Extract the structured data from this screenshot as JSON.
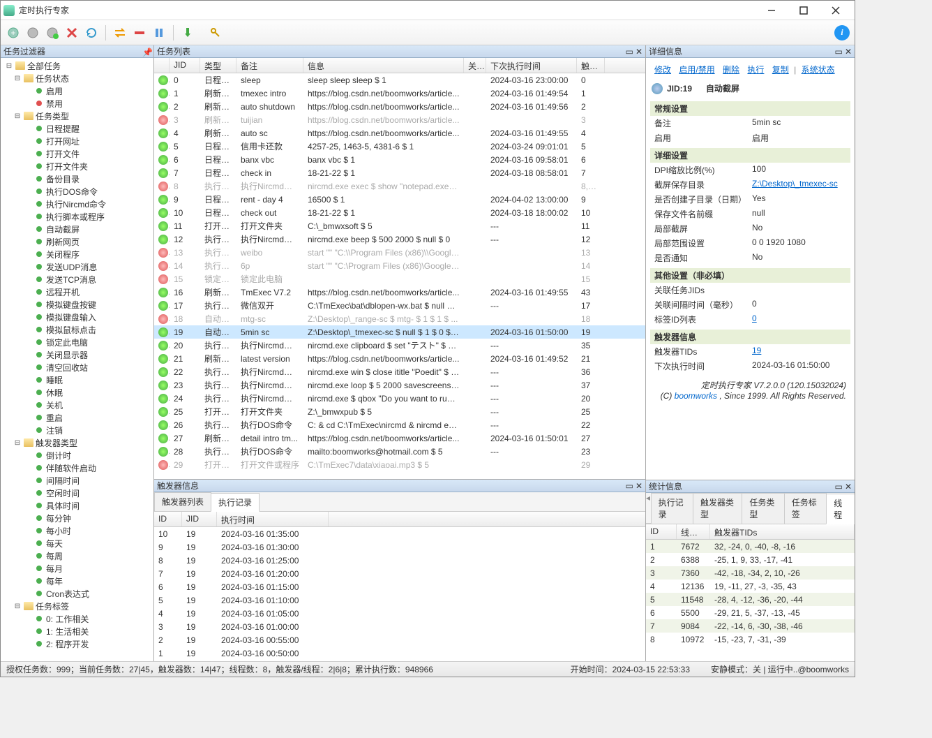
{
  "window": {
    "title": "定时执行专家"
  },
  "panes": {
    "filter": "任务过滤器",
    "tasks": "任务列表",
    "trig": "触发器信息",
    "detail": "详细信息",
    "stats": "统计信息"
  },
  "tree": {
    "all": "全部任务",
    "status": {
      "label": "任务状态",
      "enable": "启用",
      "disable": "禁用"
    },
    "types": {
      "label": "任务类型",
      "items": [
        "日程提醒",
        "打开网址",
        "打开文件",
        "打开文件夹",
        "备份目录",
        "执行DOS命令",
        "执行Nircmd命令",
        "执行脚本或程序",
        "自动截屏",
        "刷新网页",
        "关闭程序",
        "发送UDP消息",
        "发送TCP消息",
        "远程开机",
        "模拟键盘按键",
        "模拟键盘输入",
        "模拟鼠标点击",
        "锁定此电脑",
        "关闭显示器",
        "清空回收站",
        "睡眠",
        "休眠",
        "关机",
        "重启",
        "注销"
      ]
    },
    "trigtypes": {
      "label": "触发器类型",
      "items": [
        "倒计时",
        "伴随软件启动",
        "间隔时间",
        "空闲时间",
        "具体时间",
        "每分钟",
        "每小时",
        "每天",
        "每周",
        "每月",
        "每年",
        "Cron表达式"
      ]
    },
    "tags": {
      "label": "任务标签",
      "items": [
        "0: 工作相关",
        "1: 生活相关",
        "2: 程序开发"
      ]
    }
  },
  "taskCols": {
    "jid": "JID",
    "type": "类型",
    "remark": "备注",
    "info": "信息",
    "rel": "关...",
    "next": "下次执行时间",
    "trig": "触发..."
  },
  "tasks": [
    {
      "jid": 0,
      "on": true,
      "type": "日程提...",
      "remark": "sleep",
      "info": "sleep sleep sleep $ 1",
      "next": "2024-03-16 23:00:00",
      "trig": "0"
    },
    {
      "jid": 1,
      "on": true,
      "type": "刷新网...",
      "remark": "tmexec intro",
      "info": "https://blog.csdn.net/boomworks/article...",
      "next": "2024-03-16 01:49:54",
      "trig": "1"
    },
    {
      "jid": 2,
      "on": true,
      "type": "刷新网...",
      "remark": "auto shutdown",
      "info": "https://blog.csdn.net/boomworks/article...",
      "next": "2024-03-16 01:49:56",
      "trig": "2"
    },
    {
      "jid": 3,
      "on": false,
      "dis": true,
      "type": "刷新网...",
      "remark": "tuijian",
      "info": "https://blog.csdn.net/boomworks/article...",
      "next": "",
      "trig": "3"
    },
    {
      "jid": 4,
      "on": true,
      "type": "刷新网...",
      "remark": "auto sc",
      "info": "https://blog.csdn.net/boomworks/article...",
      "next": "2024-03-16 01:49:55",
      "trig": "4"
    },
    {
      "jid": 5,
      "on": true,
      "type": "日程提...",
      "remark": "信用卡还款",
      "info": "4257-25, 1463-5, 4381-6 $ 1",
      "next": "2024-03-24 09:01:01",
      "trig": "5"
    },
    {
      "jid": 6,
      "on": true,
      "type": "日程提...",
      "remark": "banx vbc",
      "info": "banx vbc $ 1",
      "next": "2024-03-16 09:58:01",
      "trig": "6"
    },
    {
      "jid": 7,
      "on": true,
      "type": "日程提...",
      "remark": "check in",
      "info": "18-21-22 $ 1",
      "next": "2024-03-18 08:58:01",
      "trig": "7"
    },
    {
      "jid": 8,
      "on": false,
      "dis": true,
      "type": "执行Ni...",
      "remark": "执行Nircmd命令",
      "info": "nircmd.exe exec $ show \"notepad.exe\" $...",
      "next": "",
      "trig": "8,16,..."
    },
    {
      "jid": 9,
      "on": true,
      "type": "日程提...",
      "remark": "rent - day 4",
      "info": "16500 $ 1",
      "next": "2024-04-02 13:00:00",
      "trig": "9"
    },
    {
      "jid": 10,
      "on": true,
      "type": "日程提...",
      "remark": "check out",
      "info": "18-21-22 $ 1",
      "next": "2024-03-18 18:00:02",
      "trig": "10"
    },
    {
      "jid": 11,
      "on": true,
      "type": "打开文...",
      "remark": "打开文件夹",
      "info": "C:\\_bmwxsoft $ 5",
      "next": "---",
      "trig": "11"
    },
    {
      "jid": 12,
      "on": true,
      "type": "执行Ni...",
      "remark": "执行Nircmd命令",
      "info": "nircmd.exe beep $ 500 2000 $ null $ 0",
      "next": "---",
      "trig": "12"
    },
    {
      "jid": 13,
      "on": false,
      "dis": true,
      "type": "执行D...",
      "remark": "weibo",
      "info": "start \"\" \"C:\\\\Program Files (x86)\\\\Google...",
      "next": "",
      "trig": "13"
    },
    {
      "jid": 14,
      "on": false,
      "dis": true,
      "type": "执行D...",
      "remark": "6p",
      "info": "start \"\" \"C:\\Program Files (x86)\\Google\\...",
      "next": "",
      "trig": "14"
    },
    {
      "jid": 15,
      "on": false,
      "dis": true,
      "type": "锁定此...",
      "remark": "锁定此电脑",
      "info": "",
      "next": "",
      "trig": "15"
    },
    {
      "jid": 16,
      "on": true,
      "type": "刷新网...",
      "remark": "TmExec V7.2",
      "info": "https://blog.csdn.net/boomworks/article...",
      "next": "2024-03-16 01:49:55",
      "trig": "43"
    },
    {
      "jid": 17,
      "on": true,
      "type": "执行脚...",
      "remark": "微信双开",
      "info": "C:\\TmExec\\bat\\dblopen-wx.bat $ null $ ...",
      "next": "---",
      "trig": "17"
    },
    {
      "jid": 18,
      "on": false,
      "dis": true,
      "type": "自动截...",
      "remark": "mtg-sc",
      "info": "Z:\\Desktop\\_range-sc $ mtg- $ 1 $ 1 $ ...",
      "next": "",
      "trig": "18"
    },
    {
      "jid": 19,
      "on": true,
      "sel": true,
      "type": "自动截...",
      "remark": "5min sc",
      "info": "Z:\\Desktop\\_tmexec-sc $ null $ 1 $ 0 $ 0...",
      "next": "2024-03-16 01:50:00",
      "trig": "19"
    },
    {
      "jid": 20,
      "on": true,
      "type": "执行Ni...",
      "remark": "执行Nircmd命令",
      "info": "nircmd.exe clipboard $ set \"テスト\" $ C:\\...",
      "next": "---",
      "trig": "35"
    },
    {
      "jid": 21,
      "on": true,
      "type": "刷新网...",
      "remark": "latest version",
      "info": "https://blog.csdn.net/boomworks/article...",
      "next": "2024-03-16 01:49:52",
      "trig": "21"
    },
    {
      "jid": 22,
      "on": true,
      "type": "执行Ni...",
      "remark": "执行Nircmd命令",
      "info": "nircmd.exe win $ close ititle \"Poedit\" $ n...",
      "next": "---",
      "trig": "36"
    },
    {
      "jid": 23,
      "on": true,
      "type": "执行Ni...",
      "remark": "执行Nircmd命令",
      "info": "nircmd.exe loop $ 5 2000 savescreensh...",
      "next": "---",
      "trig": "37"
    },
    {
      "jid": 24,
      "on": true,
      "type": "执行Ni...",
      "remark": "执行Nircmd命令",
      "info": "nircmd.exe $ qbox \"Do you want to run ...",
      "next": "---",
      "trig": "20"
    },
    {
      "jid": 25,
      "on": true,
      "type": "打开文...",
      "remark": "打开文件夹",
      "info": "Z:\\_bmwxpub $ 5",
      "next": "---",
      "trig": "25"
    },
    {
      "jid": 26,
      "on": true,
      "type": "执行D...",
      "remark": "执行DOS命令",
      "info": "C: & cd C:\\TmExec\\nircmd & nircmd exe...",
      "next": "---",
      "trig": "22"
    },
    {
      "jid": 27,
      "on": true,
      "type": "刷新网...",
      "remark": "detail intro tm...",
      "info": "https://blog.csdn.net/boomworks/article...",
      "next": "2024-03-16 01:50:01",
      "trig": "27"
    },
    {
      "jid": 28,
      "on": true,
      "type": "执行D...",
      "remark": "执行DOS命令",
      "info": "mailto:boomworks@hotmail.com $ 5",
      "next": "---",
      "trig": "23"
    },
    {
      "jid": 29,
      "on": false,
      "dis": true,
      "type": "打开文...",
      "remark": "打开文件或程序",
      "info": "C:\\TmExec7\\data\\xiaoai.mp3 $ 5",
      "next": "",
      "trig": "29"
    }
  ],
  "trigTabs": {
    "list": "触发器列表",
    "log": "执行记录"
  },
  "trigCols": {
    "id": "ID",
    "jid": "JID",
    "time": "执行时间"
  },
  "trigRows": [
    {
      "id": 10,
      "jid": 19,
      "time": "2024-03-16 01:35:00"
    },
    {
      "id": 9,
      "jid": 19,
      "time": "2024-03-16 01:30:00"
    },
    {
      "id": 8,
      "jid": 19,
      "time": "2024-03-16 01:25:00"
    },
    {
      "id": 7,
      "jid": 19,
      "time": "2024-03-16 01:20:00"
    },
    {
      "id": 6,
      "jid": 19,
      "time": "2024-03-16 01:15:00"
    },
    {
      "id": 5,
      "jid": 19,
      "time": "2024-03-16 01:10:00"
    },
    {
      "id": 4,
      "jid": 19,
      "time": "2024-03-16 01:05:00"
    },
    {
      "id": 3,
      "jid": 19,
      "time": "2024-03-16 01:00:00"
    },
    {
      "id": 2,
      "jid": 19,
      "time": "2024-03-16 00:55:00"
    },
    {
      "id": 1,
      "jid": 19,
      "time": "2024-03-16 00:50:00"
    }
  ],
  "detailLinks": {
    "edit": "修改",
    "toggle": "启用/禁用",
    "del": "删除",
    "exec": "执行",
    "copy": "复制",
    "sys": "系统状态"
  },
  "detail": {
    "jidLabel": "JID:19",
    "jidName": "自动截屏",
    "s1": "常规设置",
    "remark_k": "备注",
    "remark_v": "5min sc",
    "enable_k": "启用",
    "enable_v": "启用",
    "s2": "详细设置",
    "dpi_k": "DPI缩放比例(%)",
    "dpi_v": "100",
    "dir_k": "截屏保存目录",
    "dir_v": "Z:\\Desktop\\_tmexec-sc",
    "mkdir_k": "是否创建子目录（日期）",
    "mkdir_v": "Yes",
    "prefix_k": "保存文件名前缀",
    "prefix_v": "null",
    "partial_k": "局部截屏",
    "partial_v": "No",
    "range_k": "局部范围设置",
    "range_v": "0 0 1920 1080",
    "notify_k": "是否通知",
    "notify_v": "No",
    "s3": "其他设置（非必填）",
    "reljid_k": "关联任务JIDs",
    "gap_k": "关联间隔时间（毫秒）",
    "gap_v": "0",
    "tags_k": "标签ID列表",
    "tags_v": "0",
    "s4": "触发器信息",
    "tids_k": "触发器TIDs",
    "tids_v": "19",
    "next_k": "下次执行时间",
    "next_v": "2024-03-16 01:50:00"
  },
  "copyright": {
    "line1": "定时执行专家 V7.2.0.0 (120.15032024)",
    "line2a": "(C) ",
    "link": "boomworks",
    "line2b": " , Since 1999. All Rights Reserved."
  },
  "statsTabs": {
    "log": "执行记录",
    "trigtype": "触发器类型",
    "tasktype": "任务类型",
    "tasktag": "任务标签",
    "thread": "线程"
  },
  "statsCols": {
    "id": "ID",
    "thread": "线程ID",
    "tids": "触发器TIDs"
  },
  "statsRows": [
    {
      "id": 1,
      "th": 7672,
      "tids": "32, -24, 0, -40, -8, -16"
    },
    {
      "id": 2,
      "th": 6388,
      "tids": "-25, 1, 9, 33, -17, -41"
    },
    {
      "id": 3,
      "th": 7360,
      "tids": "-42, -18, -34, 2, 10, -26"
    },
    {
      "id": 4,
      "th": 12136,
      "tids": "19, -11, 27, -3, -35, 43"
    },
    {
      "id": 5,
      "th": 11548,
      "tids": "-28, 4, -12, -36, -20, -44"
    },
    {
      "id": 6,
      "th": 5500,
      "tids": "-29, 21, 5, -37, -13, -45"
    },
    {
      "id": 7,
      "th": 9084,
      "tids": "-22, -14, 6, -30, -38, -46"
    },
    {
      "id": 8,
      "th": 10972,
      "tids": "-15, -23, 7, -31, -39"
    }
  ],
  "status": {
    "left": "授权任务数：999；当前任务数：27|45，触发器数：14|47；线程数：8，触发器/线程：2|6|8；累计执行数：948966",
    "mid": "开始时间：2024-03-15 22:53:33",
    "right": "安静模式：关 | 运行中..@boomworks"
  }
}
